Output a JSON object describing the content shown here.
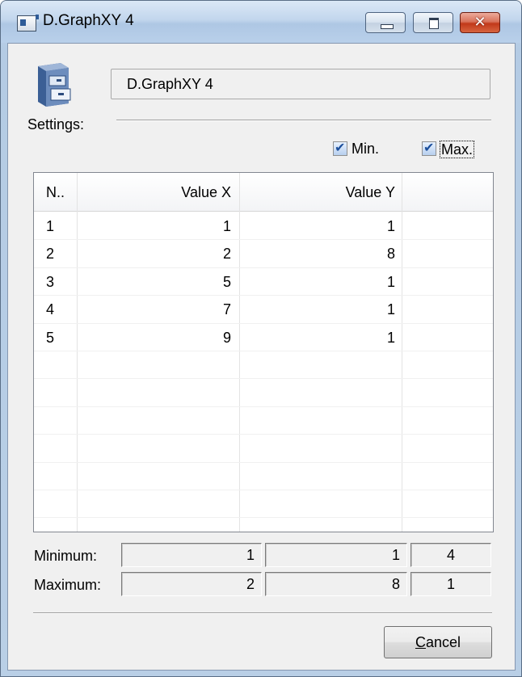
{
  "window": {
    "title": "D.GraphXY 4",
    "icon": "application-window-icon",
    "controls": [
      "minimize",
      "maximize",
      "close"
    ],
    "close_glyph": "✕"
  },
  "header": {
    "icon": "file-cabinet-icon",
    "name": "D.GraphXY 4"
  },
  "settings": {
    "label": "Settings:",
    "min_checkbox": {
      "label": "Min.",
      "checked": true
    },
    "max_checkbox": {
      "label": "Max.",
      "checked": true
    }
  },
  "table": {
    "columns": [
      "N..",
      "Value X",
      "Value Y",
      ""
    ],
    "rows": [
      {
        "n": "1",
        "x": "1",
        "y": "1"
      },
      {
        "n": "2",
        "x": "2",
        "y": "8"
      },
      {
        "n": "3",
        "x": "5",
        "y": "1"
      },
      {
        "n": "4",
        "x": "7",
        "y": "1"
      },
      {
        "n": "5",
        "x": "9",
        "y": "1"
      }
    ]
  },
  "summary": {
    "minimum": {
      "label": "Minimum:",
      "x": "1",
      "y": "1",
      "n": "4"
    },
    "maximum": {
      "label": "Maximum:",
      "x": "2",
      "y": "8",
      "n": "1"
    }
  },
  "buttons": {
    "cancel_accel": "C",
    "cancel_rest": "ancel"
  },
  "colors": {
    "titlebar": "#c2d6ed",
    "close_button": "#c2391a",
    "client_background": "#f0f0f0",
    "checkbox_check": "#1c4f9c"
  }
}
